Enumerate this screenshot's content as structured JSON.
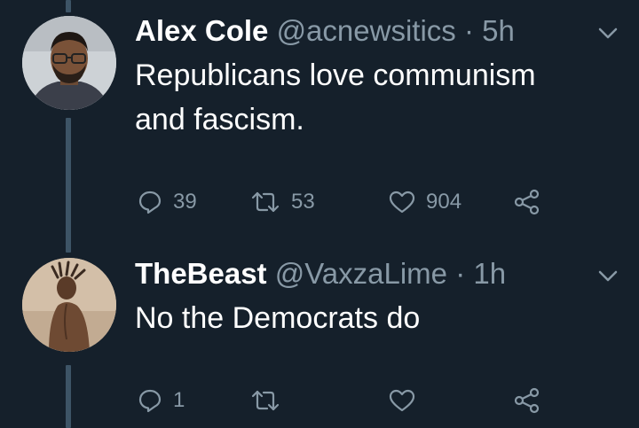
{
  "tweets": [
    {
      "display_name": "Alex Cole",
      "handle": "@acnewsitics",
      "separator": " · ",
      "time": "5h",
      "text_line1": "Republicans love communism",
      "text_line2": "and fascism.",
      "reply_count": "39",
      "retweet_count": "53",
      "like_count": "904"
    },
    {
      "display_name": "TheBeast",
      "handle": "@VaxzaLime",
      "separator": " · ",
      "time": "1h",
      "text_line1": "No the Democrats do",
      "reply_count": "1",
      "retweet_count": "",
      "like_count": ""
    }
  ],
  "icons": {
    "reply": "reply-icon",
    "retweet": "retweet-icon",
    "like": "heart-icon",
    "share": "share-icon",
    "menu": "chevron-down-icon"
  },
  "colors": {
    "background": "#15202b",
    "text_primary": "#ffffff",
    "text_secondary": "#8899a6",
    "thread_line": "#3d5466"
  }
}
